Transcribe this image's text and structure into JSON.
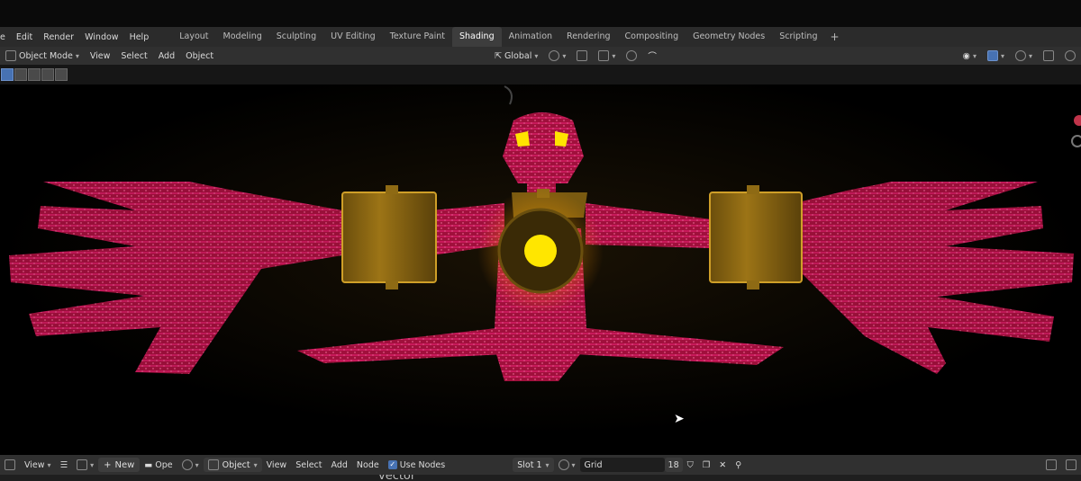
{
  "menu": {
    "edit": "Edit",
    "render": "Render",
    "window": "Window",
    "help": "Help",
    "file_partial": "e"
  },
  "workspaces": [
    "Layout",
    "Modeling",
    "Sculpting",
    "UV Editing",
    "Texture Paint",
    "Shading",
    "Animation",
    "Rendering",
    "Compositing",
    "Geometry Nodes",
    "Scripting"
  ],
  "active_workspace": "Shading",
  "add_workspace_label": "+",
  "viewport_header": {
    "mode": "Object Mode",
    "view": "View",
    "select": "Select",
    "add": "Add",
    "object": "Object",
    "orientation": "Global"
  },
  "node_editor_header": {
    "editor": "View",
    "new": "New",
    "open_partial": "Ope",
    "object_type": "Object",
    "view": "View",
    "select": "Select",
    "add": "Add",
    "node": "Node",
    "use_nodes": "Use Nodes",
    "slot": "Slot 1",
    "image_name": "Grid",
    "users": "18"
  },
  "node_strip_text": "vector",
  "colors": {
    "creature": "#c2144a",
    "glow": "#ffd800",
    "brass": "#b88a1c",
    "active_tab": "#3d3d3d",
    "accent": "#4772b3"
  }
}
